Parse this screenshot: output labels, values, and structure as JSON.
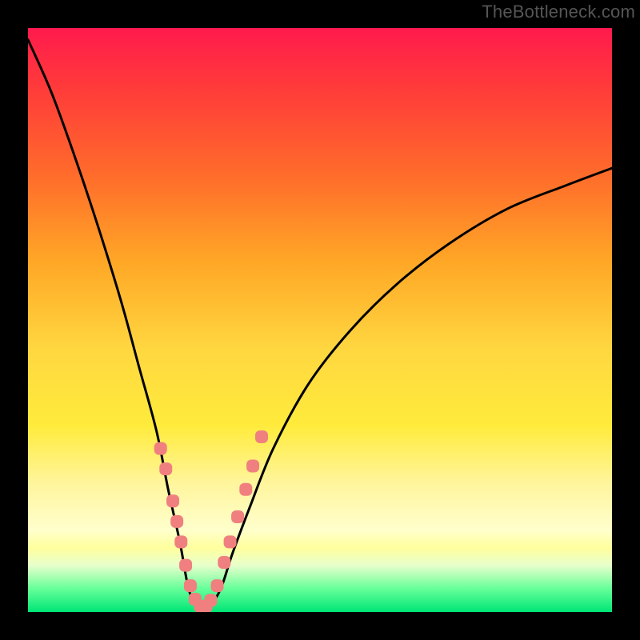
{
  "watermark": "TheBottleneck.com",
  "chart_data": {
    "type": "line",
    "title": "",
    "xlabel": "",
    "ylabel": "",
    "xlim": [
      0,
      100
    ],
    "ylim": [
      0,
      100
    ],
    "series": [
      {
        "name": "curve",
        "x": [
          0,
          4,
          8,
          12,
          16,
          19,
          22,
          24,
          26,
          27.5,
          29,
          31,
          33,
          35,
          38,
          42,
          48,
          55,
          63,
          72,
          82,
          92,
          100
        ],
        "y": [
          98,
          89,
          78,
          66,
          53,
          42,
          31,
          21,
          12,
          4,
          1,
          1,
          4,
          10,
          18,
          28,
          39,
          48,
          56,
          63,
          69,
          73,
          76
        ]
      }
    ],
    "markers": {
      "name": "highlight-points",
      "color": "#f08080",
      "x": [
        22.7,
        23.6,
        24.8,
        25.5,
        26.2,
        27.0,
        27.8,
        28.6,
        29.5,
        30.5,
        31.3,
        32.4,
        33.6,
        34.6,
        35.9,
        37.3,
        38.5,
        40.0
      ],
      "y": [
        28.0,
        24.5,
        19.0,
        15.5,
        12.0,
        8.0,
        4.5,
        2.2,
        1.0,
        1.0,
        2.0,
        4.5,
        8.5,
        12.0,
        16.3,
        21.0,
        25.0,
        30.0
      ]
    }
  }
}
